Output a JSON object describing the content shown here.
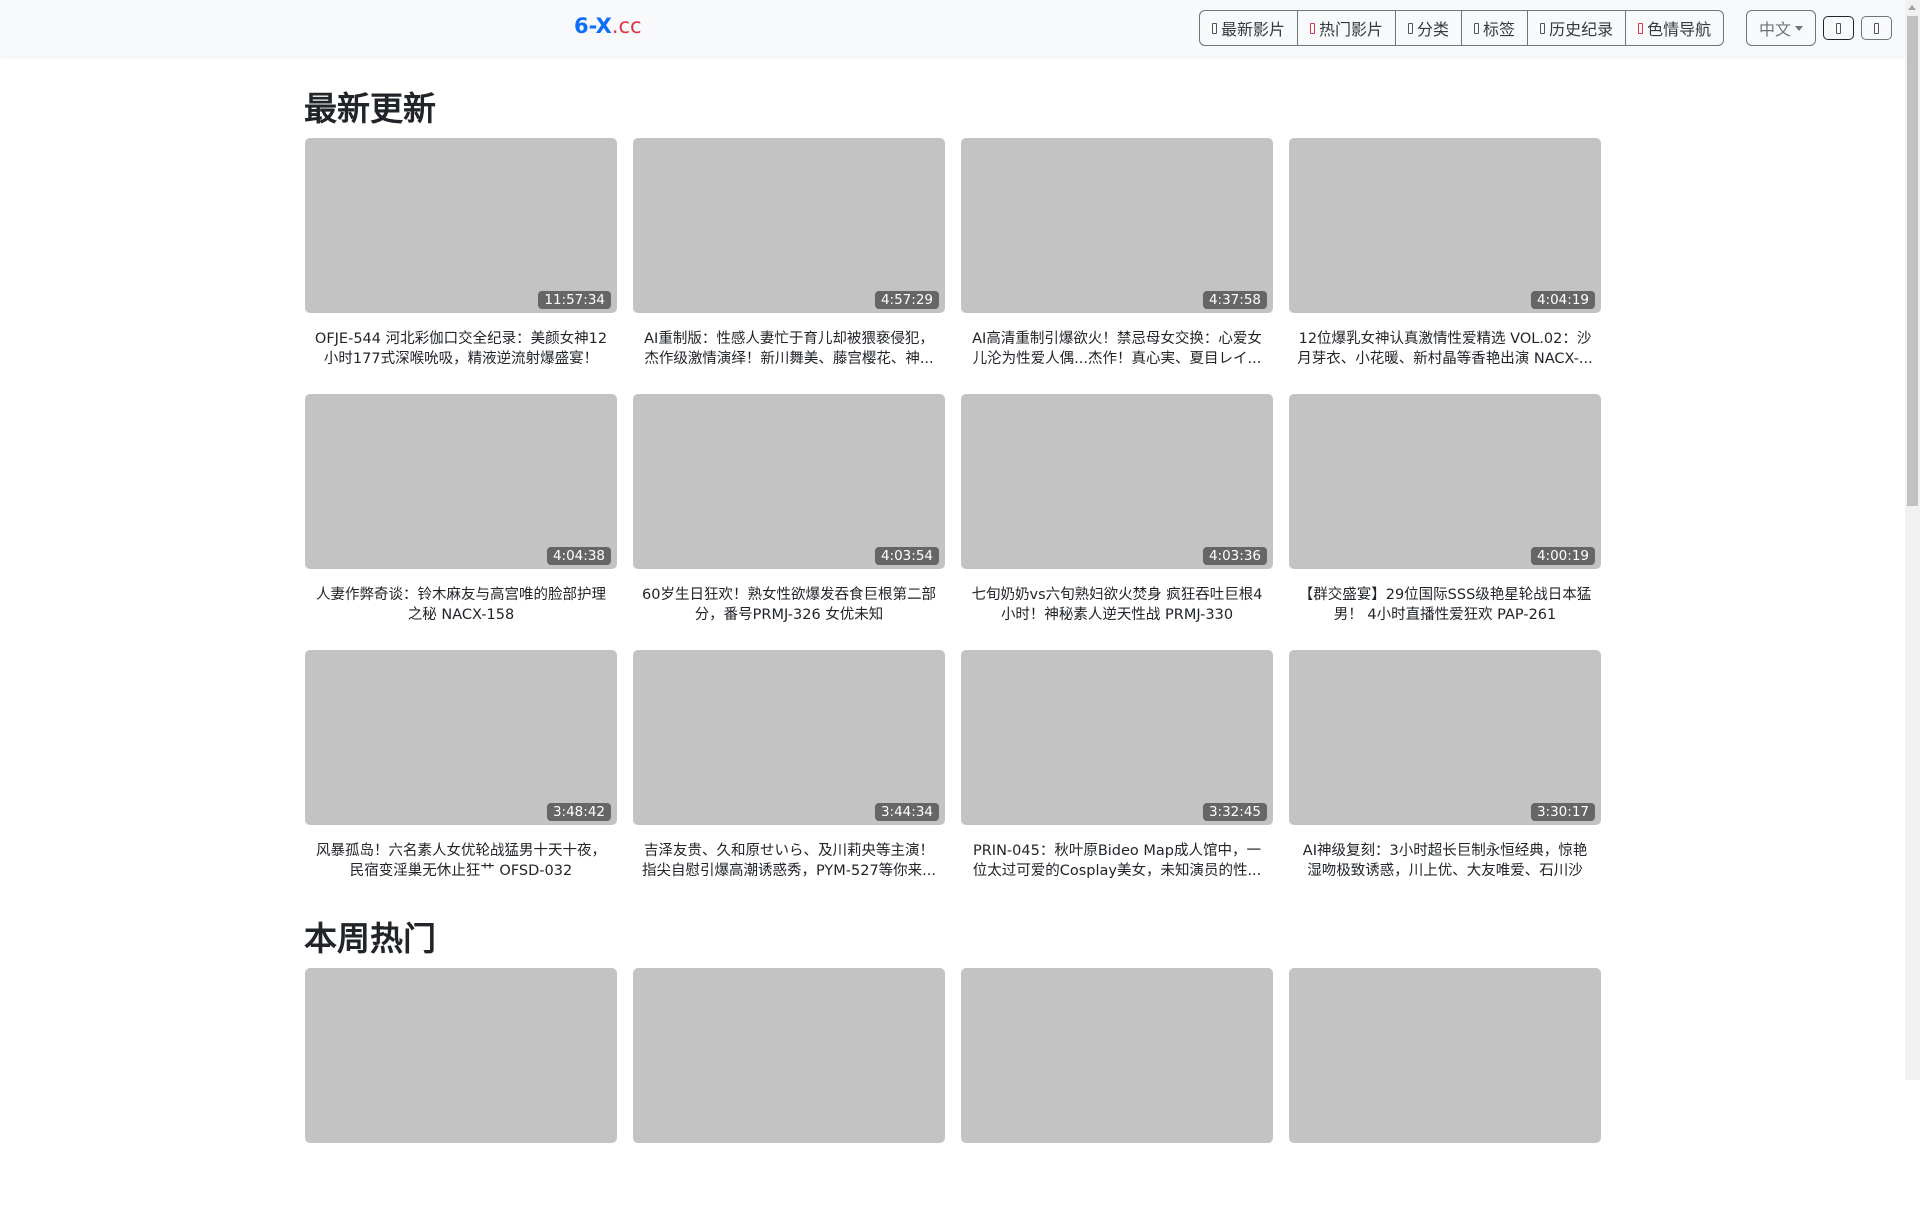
{
  "header": {
    "logo_main": "6-X",
    "logo_tld": ".cc",
    "nav": [
      {
        "label": "最新影片",
        "icon": "film-icon"
      },
      {
        "label": "热门影片",
        "icon": "fire-icon"
      },
      {
        "label": "分类",
        "icon": "category-icon"
      },
      {
        "label": "标签",
        "icon": "tag-icon"
      },
      {
        "label": "历史纪录",
        "icon": "history-icon"
      },
      {
        "label": "色情导航",
        "icon": "navigation-icon"
      }
    ],
    "language": "中文"
  },
  "sections": [
    {
      "title": "最新更新",
      "videos": [
        {
          "duration": "11:57:34",
          "title": "OFJE-544 河北彩伽口交全纪录：美颜女神12小时177式深喉吮吸，精液逆流射爆盛宴！"
        },
        {
          "duration": "4:57:29",
          "title": "AI重制版：性感人妻忙于育儿却被猥亵侵犯，杰作级激情演绎！新川舞美、藤宫樱花、神..."
        },
        {
          "duration": "4:37:58",
          "title": "AI高清重制引爆欲火！禁忌母女交换：心爱女儿沦为性爱人偶...杰作！真心実、夏目レイ..."
        },
        {
          "duration": "4:04:19",
          "title": "12位爆乳女神认真激情性爱精选 VOL.02：沙月芽衣、小花暖、新村晶等香艳出演 NACX-..."
        },
        {
          "duration": "4:04:38",
          "title": "人妻作弊奇谈：铃木麻友与高宫唯的脸部护理之秘 NACX-158"
        },
        {
          "duration": "4:03:54",
          "title": "60岁生日狂欢！熟女性欲爆发吞食巨根第二部分，番号PRMJ-326 女优未知"
        },
        {
          "duration": "4:03:36",
          "title": "七旬奶奶vs六旬熟妇欲火焚身 疯狂吞吐巨根4小时！神秘素人逆天性战 PRMJ-330"
        },
        {
          "duration": "4:00:19",
          "title": "【群交盛宴】29位国际SSS级艳星轮战日本猛男！ 4小时直播性爱狂欢 PAP-261"
        },
        {
          "duration": "3:48:42",
          "title": "风暴孤岛！六名素人女优轮战猛男十天十夜，民宿变淫巢无休止狂艹 OFSD-032"
        },
        {
          "duration": "3:44:34",
          "title": "吉泽友贵、久和原せいら、及川莉央等主演！指尖自慰引爆高潮诱惑秀，PYM-527等你来..."
        },
        {
          "duration": "3:32:45",
          "title": "PRIN-045：秋叶原Bideo Map成人馆中，一位太过可爱的Cosplay美女，未知演员的性..."
        },
        {
          "duration": "3:30:17",
          "title": "AI神级复刻：3小时超长巨制永恒经典，惊艳湿吻极致诱惑，川上优、大友唯爱、石川沙都..."
        }
      ]
    },
    {
      "title": "本周热门",
      "videos": [
        {},
        {},
        {},
        {}
      ]
    }
  ]
}
